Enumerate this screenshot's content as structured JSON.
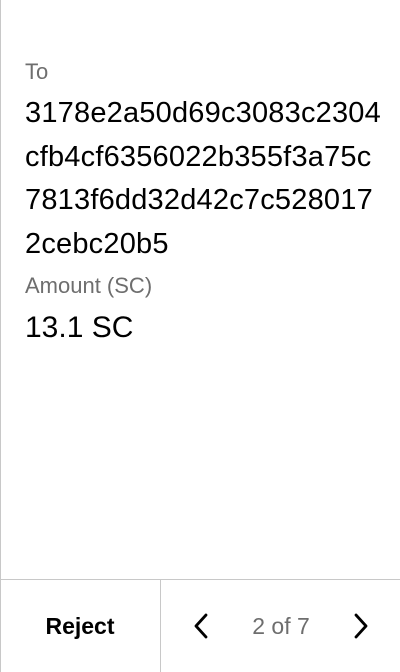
{
  "recipient": {
    "label": "To",
    "address": "3178e2a50d69c3083c2304cfb4cf6356022b355f3a75c7813f6dd32d42c7c5280172cebc20b5"
  },
  "amount": {
    "label": "Amount (SC)",
    "value": "13.1 SC"
  },
  "footer": {
    "reject_label": "Reject",
    "page_indicator": "2 of 7",
    "prev_icon": "chevron-left-icon",
    "next_icon": "chevron-right-icon"
  }
}
